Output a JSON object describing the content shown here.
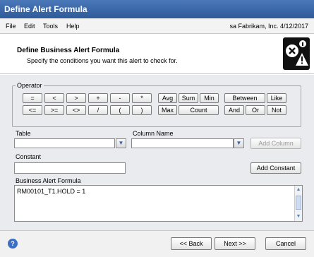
{
  "window": {
    "title": "Define Alert Formula"
  },
  "menu": {
    "items": [
      {
        "label": "File"
      },
      {
        "label": "Edit"
      },
      {
        "label": "Tools"
      },
      {
        "label": "Help"
      }
    ],
    "user_info": "sa  Fabrikam, Inc.  4/12/2017"
  },
  "header": {
    "title": "Define Business Alert Formula",
    "subtitle": "Specify the conditions you want this alert to check for.",
    "icon": "alert-warning-icon"
  },
  "operator": {
    "legend": "Operator",
    "row1": [
      "=",
      "<",
      ">",
      "+",
      "-",
      "*",
      "Avg",
      "Sum",
      "Min",
      "Between",
      "Like"
    ],
    "row2": [
      "<=",
      ">=",
      "<>",
      "/",
      "(",
      ")",
      "Max",
      "Count",
      "And",
      "Or",
      "Not"
    ]
  },
  "table": {
    "label": "Table",
    "value": ""
  },
  "column": {
    "label": "Column Name",
    "value": ""
  },
  "add_column_label": "Add Column",
  "constant": {
    "label": "Constant",
    "value": ""
  },
  "add_constant_label": "Add Constant",
  "formula": {
    "label": "Business Alert Formula",
    "value": "RM00101_T1.HOLD = 1"
  },
  "footer": {
    "back_label": "<< Back",
    "next_label": "Next >>",
    "cancel_label": "Cancel",
    "help_icon": "help-icon"
  }
}
